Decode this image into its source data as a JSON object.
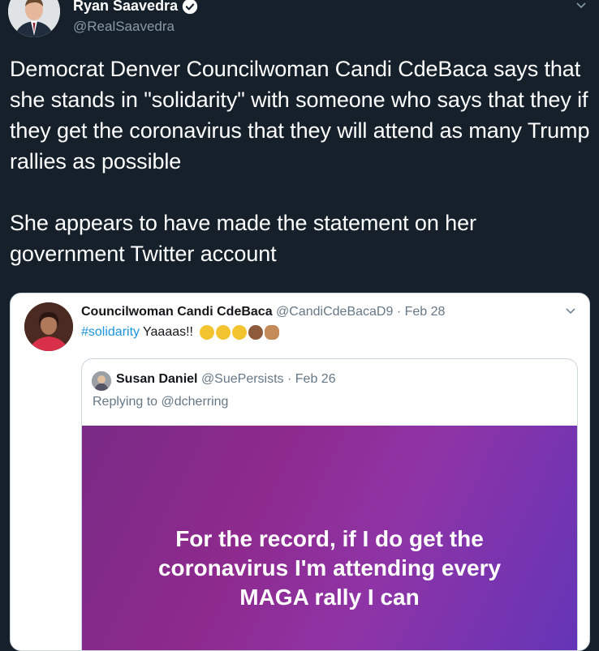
{
  "author": {
    "name": "Ryan Saavedra",
    "handle": "@RealSaavedra"
  },
  "tweet": {
    "text": "Democrat Denver Councilwoman Candi CdeBaca says that she stands in \"solidarity\" with someone who says that they if they get the coronavirus that they will attend as many Trump rallies as possible\n\nShe appears to have made the statement on her government Twitter account"
  },
  "embedded": {
    "name": "Councilwoman Candi CdeBaca",
    "handle": "@CandiCdeBacaD9",
    "dot": "·",
    "date": "Feb 28",
    "hashtag": "#solidarity",
    "text": "Yaaaas!!",
    "quoted": {
      "name": "Susan Daniel",
      "handle": "@SuePersists",
      "dot": "·",
      "date": "Feb 26",
      "replying_label": "Replying to",
      "replying_handle": "@dcherring",
      "image_text": "For the record, if I do get the\ncoronavirus I'm attending every\nMAGA rally I can"
    }
  },
  "colors": {
    "background": "#15202b",
    "link": "#1b95e0",
    "secondary_text": "#657786"
  }
}
